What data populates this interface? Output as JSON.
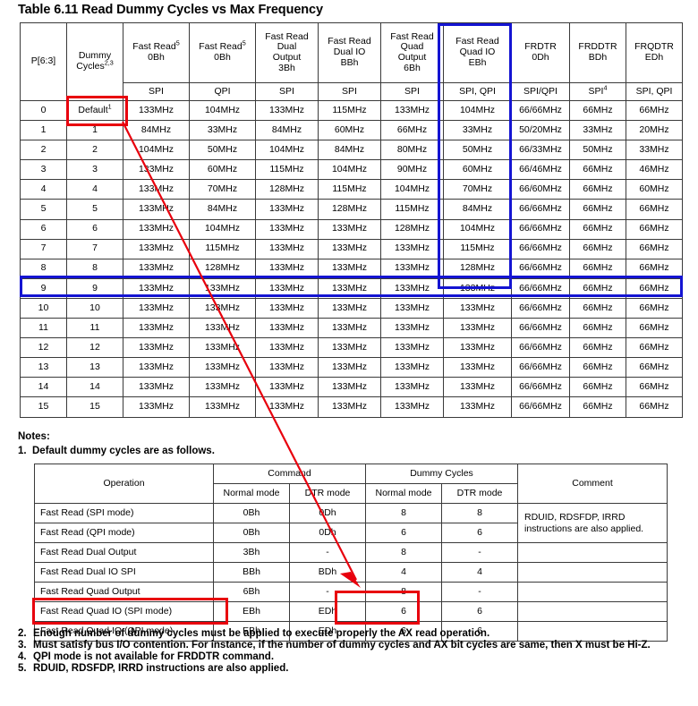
{
  "title": "Table 6.11 Read Dummy Cycles vs Max Frequency",
  "main_table": {
    "headers": [
      {
        "label": "P[6:3]",
        "sup": ""
      },
      {
        "label": "Dummy\nCycles",
        "sup": "2,3"
      },
      {
        "label": "Fast Read",
        "sup": "5",
        "sub": "0Bh"
      },
      {
        "label": "Fast Read",
        "sup": "5",
        "sub": "0Bh"
      },
      {
        "label": "Fast Read\nDual\nOutput\n3Bh",
        "sup": ""
      },
      {
        "label": "Fast Read\nDual IO\nBBh",
        "sup": ""
      },
      {
        "label": "Fast Read\nQuad\nOutput\n6Bh",
        "sup": ""
      },
      {
        "label": "Fast Read\nQuad IO\nEBh",
        "sup": ""
      },
      {
        "label": "FRDTR\n0Dh",
        "sup": ""
      },
      {
        "label": "FRDDTR\nBDh",
        "sup": ""
      },
      {
        "label": "FRQDTR\nEDh",
        "sup": ""
      }
    ],
    "mode_row": [
      "",
      "",
      "SPI",
      "QPI",
      "SPI",
      "SPI",
      "SPI",
      "SPI, QPI",
      "SPI/QPI",
      "SPI",
      "SPI, QPI"
    ],
    "mode_row_sup": [
      "",
      "",
      "",
      "",
      "",
      "",
      "",
      "",
      "",
      "4",
      ""
    ],
    "rows": [
      {
        "p": "0",
        "dummy": "Default",
        "dummy_sup": "1",
        "cells": [
          "133MHz",
          "104MHz",
          "133MHz",
          "115MHz",
          "133MHz",
          "104MHz",
          "66/66MHz",
          "66MHz",
          "66MHz"
        ]
      },
      {
        "p": "1",
        "dummy": "1",
        "dummy_sup": "",
        "cells": [
          "84MHz",
          "33MHz",
          "84MHz",
          "60MHz",
          "66MHz",
          "33MHz",
          "50/20MHz",
          "33MHz",
          "20MHz"
        ]
      },
      {
        "p": "2",
        "dummy": "2",
        "dummy_sup": "",
        "cells": [
          "104MHz",
          "50MHz",
          "104MHz",
          "84MHz",
          "80MHz",
          "50MHz",
          "66/33MHz",
          "50MHz",
          "33MHz"
        ]
      },
      {
        "p": "3",
        "dummy": "3",
        "dummy_sup": "",
        "cells": [
          "133MHz",
          "60MHz",
          "115MHz",
          "104MHz",
          "90MHz",
          "60MHz",
          "66/46MHz",
          "66MHz",
          "46MHz"
        ]
      },
      {
        "p": "4",
        "dummy": "4",
        "dummy_sup": "",
        "cells": [
          "133MHz",
          "70MHz",
          "128MHz",
          "115MHz",
          "104MHz",
          "70MHz",
          "66/60MHz",
          "66MHz",
          "60MHz"
        ]
      },
      {
        "p": "5",
        "dummy": "5",
        "dummy_sup": "",
        "cells": [
          "133MHz",
          "84MHz",
          "133MHz",
          "128MHz",
          "115MHz",
          "84MHz",
          "66/66MHz",
          "66MHz",
          "66MHz"
        ]
      },
      {
        "p": "6",
        "dummy": "6",
        "dummy_sup": "",
        "cells": [
          "133MHz",
          "104MHz",
          "133MHz",
          "133MHz",
          "128MHz",
          "104MHz",
          "66/66MHz",
          "66MHz",
          "66MHz"
        ]
      },
      {
        "p": "7",
        "dummy": "7",
        "dummy_sup": "",
        "cells": [
          "133MHz",
          "115MHz",
          "133MHz",
          "133MHz",
          "133MHz",
          "115MHz",
          "66/66MHz",
          "66MHz",
          "66MHz"
        ]
      },
      {
        "p": "8",
        "dummy": "8",
        "dummy_sup": "",
        "cells": [
          "133MHz",
          "128MHz",
          "133MHz",
          "133MHz",
          "133MHz",
          "128MHz",
          "66/66MHz",
          "66MHz",
          "66MHz"
        ]
      },
      {
        "p": "9",
        "dummy": "9",
        "dummy_sup": "",
        "cells": [
          "133MHz",
          "133MHz",
          "133MHz",
          "133MHz",
          "133MHz",
          "133MHz",
          "66/66MHz",
          "66MHz",
          "66MHz"
        ]
      },
      {
        "p": "10",
        "dummy": "10",
        "dummy_sup": "",
        "cells": [
          "133MHz",
          "133MHz",
          "133MHz",
          "133MHz",
          "133MHz",
          "133MHz",
          "66/66MHz",
          "66MHz",
          "66MHz"
        ]
      },
      {
        "p": "11",
        "dummy": "11",
        "dummy_sup": "",
        "cells": [
          "133MHz",
          "133MHz",
          "133MHz",
          "133MHz",
          "133MHz",
          "133MHz",
          "66/66MHz",
          "66MHz",
          "66MHz"
        ]
      },
      {
        "p": "12",
        "dummy": "12",
        "dummy_sup": "",
        "cells": [
          "133MHz",
          "133MHz",
          "133MHz",
          "133MHz",
          "133MHz",
          "133MHz",
          "66/66MHz",
          "66MHz",
          "66MHz"
        ]
      },
      {
        "p": "13",
        "dummy": "13",
        "dummy_sup": "",
        "cells": [
          "133MHz",
          "133MHz",
          "133MHz",
          "133MHz",
          "133MHz",
          "133MHz",
          "66/66MHz",
          "66MHz",
          "66MHz"
        ]
      },
      {
        "p": "14",
        "dummy": "14",
        "dummy_sup": "",
        "cells": [
          "133MHz",
          "133MHz",
          "133MHz",
          "133MHz",
          "133MHz",
          "133MHz",
          "66/66MHz",
          "66MHz",
          "66MHz"
        ]
      },
      {
        "p": "15",
        "dummy": "15",
        "dummy_sup": "",
        "cells": [
          "133MHz",
          "133MHz",
          "133MHz",
          "133MHz",
          "133MHz",
          "133MHz",
          "66/66MHz",
          "66MHz",
          "66MHz"
        ]
      }
    ]
  },
  "notes_heading": "Notes:",
  "note_1": {
    "num": "1.",
    "text": "Default dummy cycles are as follows."
  },
  "sub_table": {
    "group_headers": {
      "operation": "Operation",
      "command": "Command",
      "dummy_cycles": "Dummy Cycles",
      "comment": "Comment"
    },
    "sub_headers": [
      "Normal mode",
      "DTR mode",
      "Normal mode",
      "DTR mode"
    ],
    "rows": [
      {
        "operation": "Fast Read (SPI mode)",
        "cmd_normal": "0Bh",
        "cmd_dtr": "0Dh",
        "dc_normal": "8",
        "dc_dtr": "8"
      },
      {
        "operation": "Fast Read (QPI mode)",
        "cmd_normal": "0Bh",
        "cmd_dtr": "0Dh",
        "dc_normal": "6",
        "dc_dtr": "6"
      },
      {
        "operation": "Fast Read Dual Output",
        "cmd_normal": "3Bh",
        "cmd_dtr": "-",
        "dc_normal": "8",
        "dc_dtr": "-"
      },
      {
        "operation": "Fast Read Dual IO SPI",
        "cmd_normal": "BBh",
        "cmd_dtr": "BDh",
        "dc_normal": "4",
        "dc_dtr": "4"
      },
      {
        "operation": "Fast Read Quad Output",
        "cmd_normal": "6Bh",
        "cmd_dtr": "-",
        "dc_normal": "8",
        "dc_dtr": "-"
      },
      {
        "operation": "Fast Read Quad IO (SPI mode)",
        "cmd_normal": "EBh",
        "cmd_dtr": "EDh",
        "dc_normal": "6",
        "dc_dtr": "6"
      },
      {
        "operation": "Fast Read Quad IO (QPI mode)",
        "cmd_normal": "EBh",
        "cmd_dtr": "EDh",
        "dc_normal": "6",
        "dc_dtr": "6"
      }
    ],
    "comment": "RDUID, RDSFDP, IRRD instructions are also applied."
  },
  "bottom_notes": [
    {
      "num": "2.",
      "text": "Enough number of dummy cycles must be applied to execute properly the AX read operation."
    },
    {
      "num": "3.",
      "text": "Must satisfy bus I/O contention. For instance, if the number of dummy cycles and AX bit cycles are same, then X must be Hi-Z."
    },
    {
      "num": "4.",
      "text": "QPI mode is not available for FRDDTR command."
    },
    {
      "num": "5.",
      "text": "RDUID, RDSFDP, IRRD instructions are also applied."
    }
  ],
  "annotations": {
    "red_color": "#e8000d",
    "blue_color": "#1414d2",
    "red_box_default_label": "Default cell highlight",
    "blue_box_column_label": "Fast Read Quad IO EBh column highlight",
    "blue_box_row_label": "Dummy cycles 9 row highlight",
    "red_box_qpi_row_label": "Fast Read Quad IO (QPI mode) row highlight",
    "red_box_dummy_label": "Dummy cycles value 6 highlight",
    "arrow_label": "Default maps to 6 dummy cycles"
  }
}
